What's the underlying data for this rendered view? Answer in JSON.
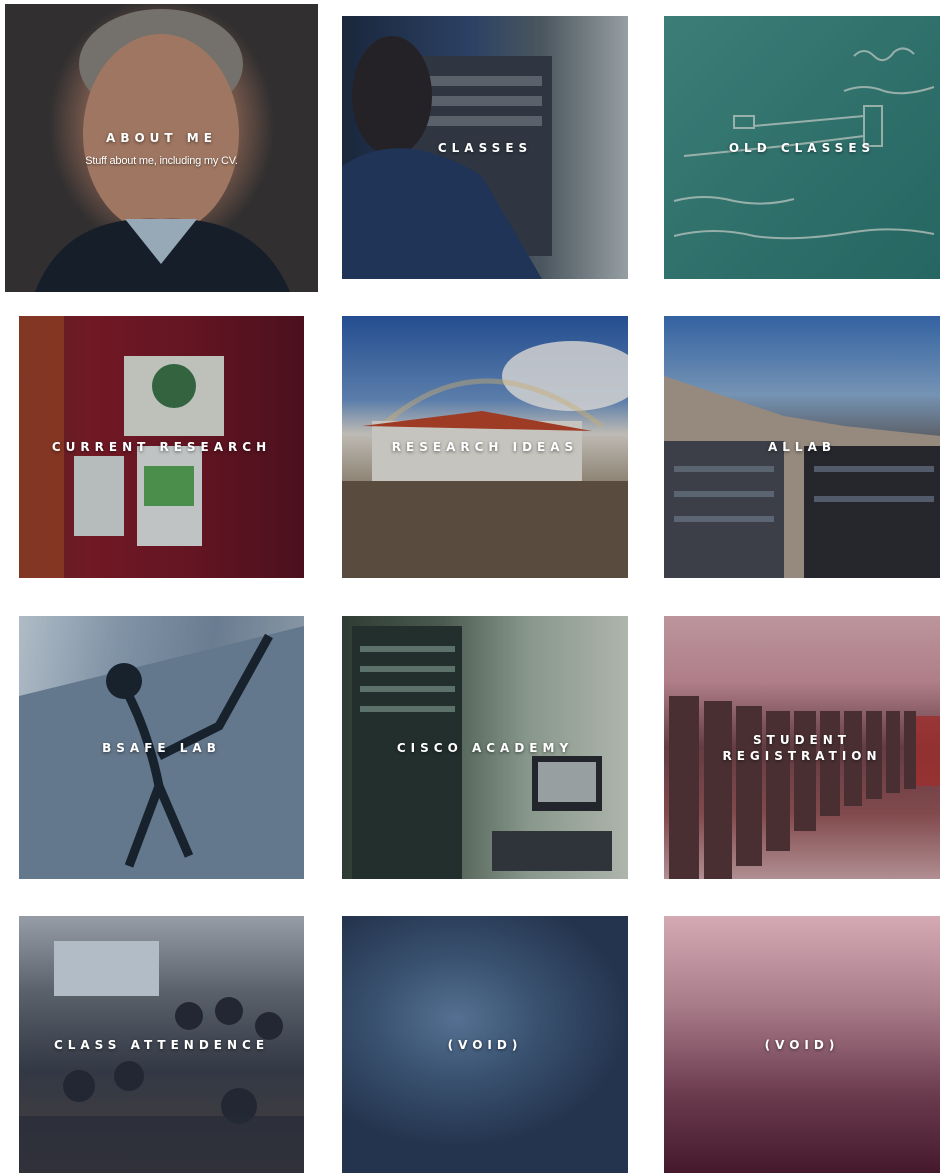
{
  "tiles": [
    {
      "title": "ABOUT ME",
      "subtitle": "Stuff about me, including my CV."
    },
    {
      "title": "CLASSES"
    },
    {
      "title": "OLD CLASSES"
    },
    {
      "title": "CURRENT RESEARCH"
    },
    {
      "title": "RESEARCH IDEAS"
    },
    {
      "title": "ALLAB"
    },
    {
      "title": "BSAFE LAB"
    },
    {
      "title": "CISCO ACADEMY"
    },
    {
      "title": "STUDENT REGISTRATION"
    },
    {
      "title": "CLASS ATTENDENCE"
    },
    {
      "title": "(VOID)"
    },
    {
      "title": "(VOID)"
    }
  ]
}
